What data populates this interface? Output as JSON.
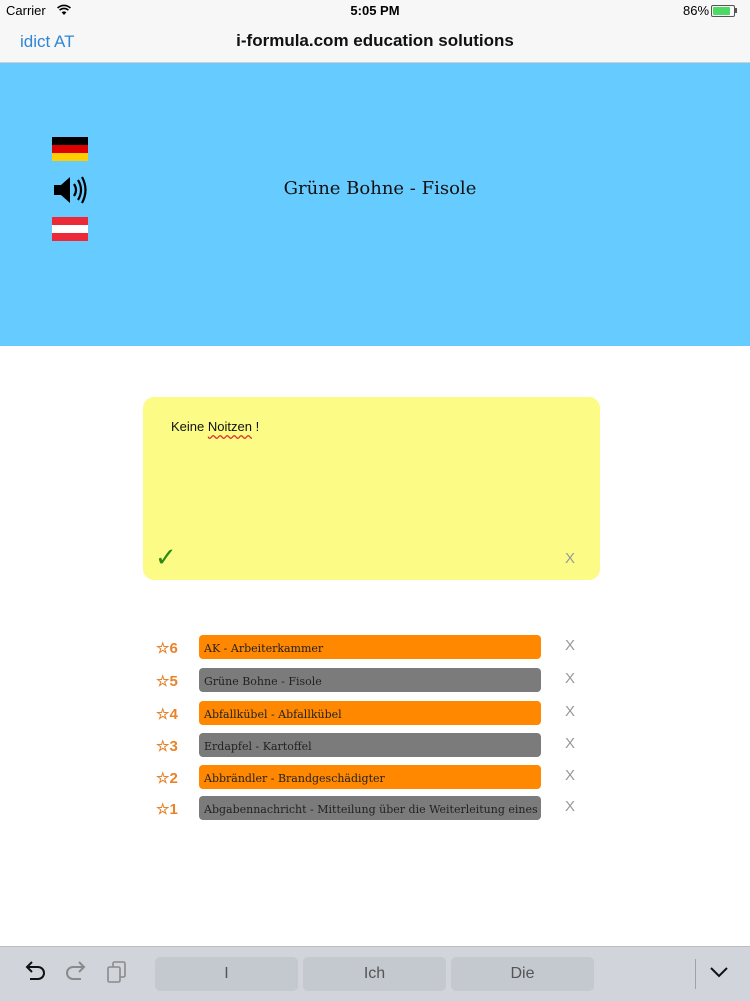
{
  "status_bar": {
    "carrier": "Carrier",
    "time": "5:05 PM",
    "battery": "86%"
  },
  "nav": {
    "back": "idict AT",
    "title": "i-formula.com education solutions"
  },
  "word_panel": {
    "title": "Grüne Bohne - Fisole"
  },
  "note": {
    "text_a": "Keine ",
    "text_b": "Noitzen",
    "text_c": " !",
    "clear": "X"
  },
  "history": [
    {
      "star": "☆6",
      "text": "AK - Arbeiterkammer",
      "color": "orange",
      "remove": "X"
    },
    {
      "star": "☆5",
      "text": "Grüne Bohne - Fisole",
      "color": "gray",
      "remove": "X"
    },
    {
      "star": "☆4",
      "text": "Abfallkübel - Abfallkübel",
      "color": "orange",
      "remove": "X"
    },
    {
      "star": "☆3",
      "text": "Erdapfel - Kartoffel",
      "color": "gray",
      "remove": "X"
    },
    {
      "star": "☆2",
      "text": "Abbrändler - Brandgeschädigter",
      "color": "orange",
      "remove": "X"
    },
    {
      "star": "☆1",
      "text": "Abgabennachricht - Mitteilung über die Weiterleitung eines",
      "color": "gray",
      "remove": "X"
    }
  ],
  "keyboard": {
    "suggestions": [
      "I",
      "Ich",
      "Die"
    ]
  },
  "colors": {
    "accent": "#2f87d4",
    "panel": "#66ccff",
    "note": "#fbfb86",
    "orange": "#ff8800",
    "gray": "#7b7b7b"
  }
}
